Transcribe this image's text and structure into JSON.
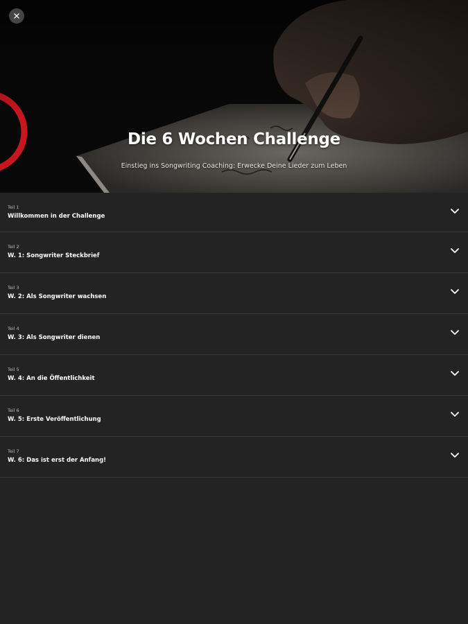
{
  "hero": {
    "title": "Die 6 Wochen Challenge",
    "subtitle": "Einstieg ins Songwriting Coaching: Erwecke Deine Lieder zum Leben"
  },
  "close_icon": "close-icon",
  "expand_icon": "chevron-down-icon",
  "colors": {
    "background": "#232323",
    "divider": "#3a3a3a",
    "text": "#ffffff",
    "accent_ring": "#c8161d"
  },
  "modules": [
    {
      "part": "Teil 1",
      "title": "Willkommen in der Challenge"
    },
    {
      "part": "Teil 2",
      "title": "W. 1: Songwriter Steckbrief"
    },
    {
      "part": "Teil 3",
      "title": "W. 2: Als Songwriter wachsen"
    },
    {
      "part": "Teil 4",
      "title": "W. 3: Als Songwriter dienen"
    },
    {
      "part": "Teil 5",
      "title": "W. 4: An die Öffentlichkeit"
    },
    {
      "part": "Teil 6",
      "title": "W. 5: Erste Veröffentlichung"
    },
    {
      "part": "Teil 7",
      "title": "W. 6: Das ist erst der Anfang!"
    }
  ]
}
